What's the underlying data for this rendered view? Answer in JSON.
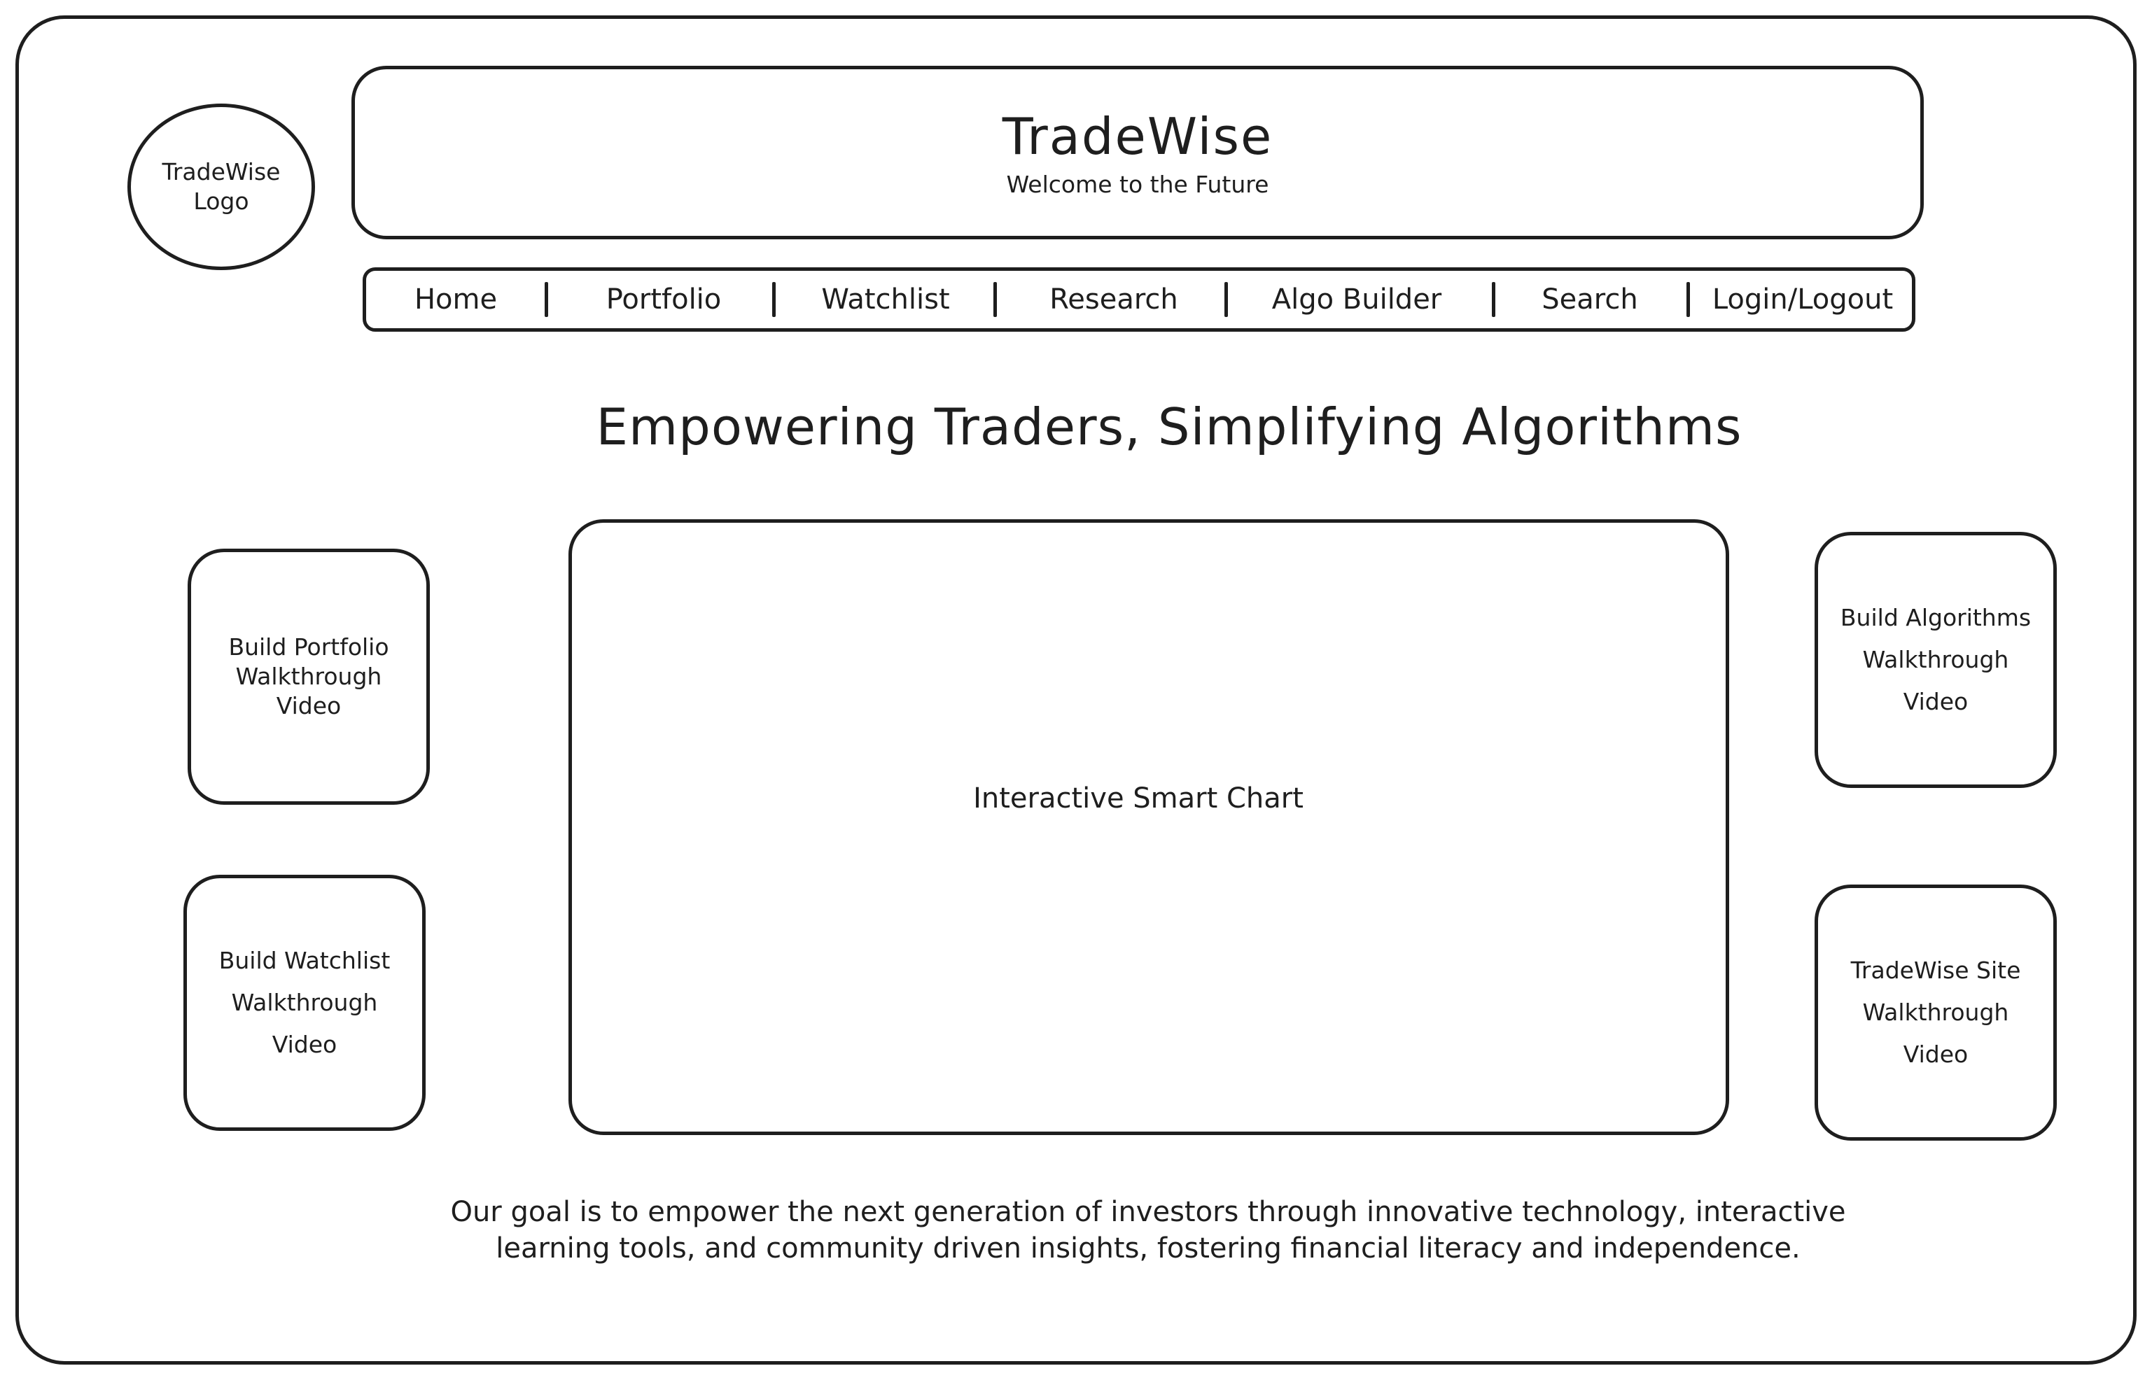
{
  "logo": {
    "lines": [
      "TradeWise",
      "Logo"
    ]
  },
  "header": {
    "title": "TradeWise",
    "subtitle": "Welcome to the Future"
  },
  "nav": {
    "items": [
      "Home",
      "Portfolio",
      "Watchlist",
      "Research",
      "Algo Builder",
      "Search",
      "Login/Logout"
    ]
  },
  "tagline": "Empowering Traders, Simplifying Algorithms",
  "chart_placeholder": {
    "label": "Interactive Smart Chart"
  },
  "cards": {
    "portfolio": [
      "Build Portfolio",
      "Walkthrough",
      "Video"
    ],
    "watchlist": [
      "Build Watchlist",
      "Walkthrough",
      "Video"
    ],
    "algorithms": [
      "Build Algorithms",
      "Walkthrough",
      "Video"
    ],
    "site": [
      "TradeWise Site",
      "Walkthrough",
      "Video"
    ]
  },
  "mission": {
    "lines": [
      "Our goal is to empower the next generation of investors through innovative technology, interactive",
      "learning tools, and community driven insights, fostering financial literacy and independence."
    ]
  }
}
